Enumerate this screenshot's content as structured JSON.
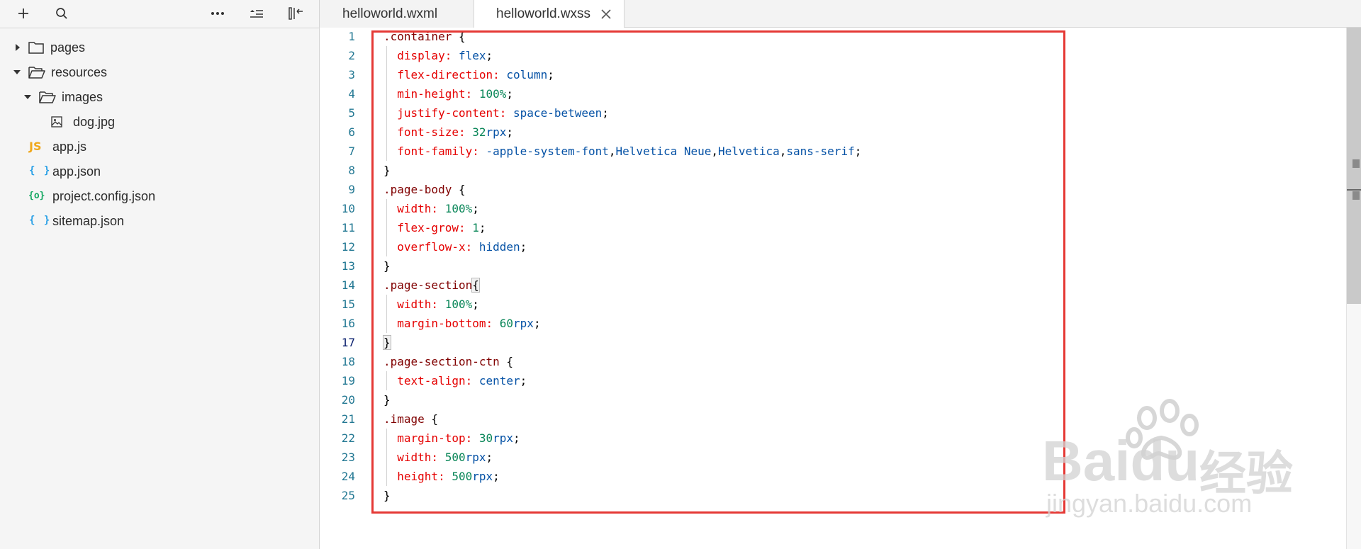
{
  "sidebar": {
    "toolbar": {
      "add_icon": "plus-icon",
      "search_icon": "search-icon",
      "more_icon": "more-icon",
      "collapse_icon": "collapse-icon",
      "toggle_icon": "panel-toggle-icon"
    },
    "tree": [
      {
        "label": "pages",
        "type": "folder",
        "expanded": false,
        "depth": 0
      },
      {
        "label": "resources",
        "type": "folder",
        "expanded": true,
        "depth": 0
      },
      {
        "label": "images",
        "type": "folder",
        "expanded": true,
        "depth": 1
      },
      {
        "label": "dog.jpg",
        "type": "image",
        "depth": 2
      },
      {
        "label": "app.js",
        "type": "js",
        "icon_text": "JS",
        "depth": 0
      },
      {
        "label": "app.json",
        "type": "json",
        "icon_text": "{ }",
        "depth": 0
      },
      {
        "label": "project.config.json",
        "type": "config",
        "icon_text": "{o}",
        "depth": 0
      },
      {
        "label": "sitemap.json",
        "type": "json",
        "icon_text": "{ }",
        "depth": 0
      }
    ]
  },
  "tabs": [
    {
      "label": "helloworld.wxml",
      "active": false
    },
    {
      "label": "helloworld.wxss",
      "active": true
    }
  ],
  "editor": {
    "current_line": 17,
    "lines": [
      [
        [
          ".container",
          "sel"
        ],
        [
          " {",
          "br"
        ]
      ],
      [
        [
          "  "
        ],
        [
          "display:",
          "prop"
        ],
        [
          " "
        ],
        [
          "flex",
          "val"
        ],
        [
          ";",
          "punc"
        ]
      ],
      [
        [
          "  "
        ],
        [
          "flex-direction:",
          "prop"
        ],
        [
          " "
        ],
        [
          "column",
          "val"
        ],
        [
          ";",
          "punc"
        ]
      ],
      [
        [
          "  "
        ],
        [
          "min-height:",
          "prop"
        ],
        [
          " "
        ],
        [
          "100%",
          "num"
        ],
        [
          ";",
          "punc"
        ]
      ],
      [
        [
          "  "
        ],
        [
          "justify-content:",
          "prop"
        ],
        [
          " "
        ],
        [
          "space-between",
          "val"
        ],
        [
          ";",
          "punc"
        ]
      ],
      [
        [
          "  "
        ],
        [
          "font-size:",
          "prop"
        ],
        [
          " "
        ],
        [
          "32",
          "num"
        ],
        [
          "rpx",
          "val"
        ],
        [
          ";",
          "punc"
        ]
      ],
      [
        [
          "  "
        ],
        [
          "font-family:",
          "prop"
        ],
        [
          " "
        ],
        [
          "-apple-system-font",
          "val"
        ],
        [
          ",",
          "punc"
        ],
        [
          "Helvetica Neue",
          "val"
        ],
        [
          ",",
          "punc"
        ],
        [
          "Helvetica",
          "val"
        ],
        [
          ",",
          "punc"
        ],
        [
          "sans-serif",
          "val"
        ],
        [
          ";",
          "punc"
        ]
      ],
      [
        [
          "}",
          "br"
        ]
      ],
      [
        [
          ".page-body",
          "sel"
        ],
        [
          " {",
          "br"
        ]
      ],
      [
        [
          "  "
        ],
        [
          "width:",
          "prop"
        ],
        [
          " "
        ],
        [
          "100%",
          "num"
        ],
        [
          ";",
          "punc"
        ]
      ],
      [
        [
          "  "
        ],
        [
          "flex-grow:",
          "prop"
        ],
        [
          " "
        ],
        [
          "1",
          "num"
        ],
        [
          ";",
          "punc"
        ]
      ],
      [
        [
          "  "
        ],
        [
          "overflow-x:",
          "prop"
        ],
        [
          " "
        ],
        [
          "hidden",
          "val"
        ],
        [
          ";",
          "punc"
        ]
      ],
      [
        [
          "}",
          "br"
        ]
      ],
      [
        [
          ".page-section",
          "sel"
        ],
        [
          "{",
          "br match"
        ]
      ],
      [
        [
          "  "
        ],
        [
          "width:",
          "prop"
        ],
        [
          " "
        ],
        [
          "100%",
          "num"
        ],
        [
          ";",
          "punc"
        ]
      ],
      [
        [
          "  "
        ],
        [
          "margin-bottom:",
          "prop"
        ],
        [
          " "
        ],
        [
          "60",
          "num"
        ],
        [
          "rpx",
          "val"
        ],
        [
          ";",
          "punc"
        ]
      ],
      [
        [
          "}",
          "br match"
        ]
      ],
      [
        [
          ".page-section-ctn",
          "sel"
        ],
        [
          " {",
          "br"
        ]
      ],
      [
        [
          "  "
        ],
        [
          "text-align:",
          "prop"
        ],
        [
          " "
        ],
        [
          "center",
          "val"
        ],
        [
          ";",
          "punc"
        ]
      ],
      [
        [
          "}",
          "br"
        ]
      ],
      [
        [
          ".image",
          "sel"
        ],
        [
          " {",
          "br"
        ]
      ],
      [
        [
          "  "
        ],
        [
          "margin-top:",
          "prop"
        ],
        [
          " "
        ],
        [
          "30",
          "num"
        ],
        [
          "rpx",
          "val"
        ],
        [
          ";",
          "punc"
        ]
      ],
      [
        [
          "  "
        ],
        [
          "width:",
          "prop"
        ],
        [
          " "
        ],
        [
          "500",
          "num"
        ],
        [
          "rpx",
          "val"
        ],
        [
          ";",
          "punc"
        ]
      ],
      [
        [
          "  "
        ],
        [
          "height:",
          "prop"
        ],
        [
          " "
        ],
        [
          "500",
          "num"
        ],
        [
          "rpx",
          "val"
        ],
        [
          ";",
          "punc"
        ]
      ],
      [
        [
          "}",
          "br"
        ]
      ]
    ]
  },
  "watermark": {
    "brand": "Baidu",
    "cn": "经验",
    "url": "jingyan.baidu.com"
  },
  "colors": {
    "selector": "#800000",
    "property": "#e50000",
    "value": "#0451a5",
    "number": "#098658",
    "line_number": "#237893",
    "highlight_box": "#e53935"
  }
}
